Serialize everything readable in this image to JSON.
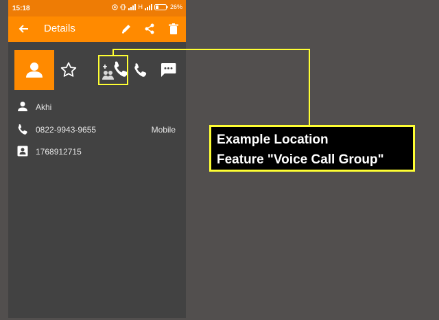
{
  "status_bar": {
    "time": "15:18",
    "network": "H",
    "battery": "26%"
  },
  "app_bar": {
    "title": "Details",
    "back_icon": "arrow-back-icon",
    "actions": [
      "edit-icon",
      "share-icon",
      "delete-icon"
    ]
  },
  "contact": {
    "name": "Akhi",
    "phone": "0822-9943-9655",
    "phone_type": "Mobile",
    "id_number": "1768912715"
  },
  "action_icons": [
    "star-icon",
    "voice-call-group-icon",
    "phone-icon",
    "message-icon"
  ],
  "callout": {
    "line1": "Example Location",
    "line2": "Feature \"Voice Call Group\""
  },
  "colors": {
    "primary": "#ff8a00",
    "status_bar": "#ee7c05",
    "background": "#424242",
    "highlight": "#ffff33"
  }
}
